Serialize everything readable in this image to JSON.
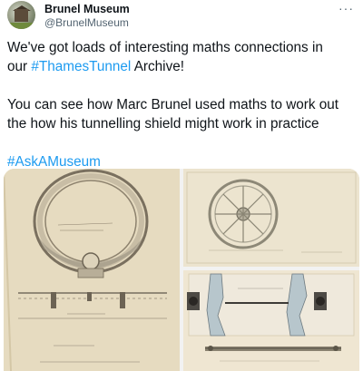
{
  "tweet": {
    "display_name": "Brunel Museum",
    "handle": "@BrunelMuseum",
    "more_label": "···",
    "line1_before": "We've got loads of interesting maths connections in",
    "line2_before": "our ",
    "hashtag1": "#ThamesTunnel",
    "line2_after": " Archive!",
    "para2_line1": "You can see how Marc Brunel used maths to work out",
    "para2_line2": "the how his tunnelling shield might work in practice",
    "hashtag2": "#AskAMuseum"
  },
  "colors": {
    "text": "#0f1419",
    "secondary": "#536471",
    "link": "#1d9bf0"
  },
  "icons": {
    "more": "more-horizontal-icon"
  }
}
